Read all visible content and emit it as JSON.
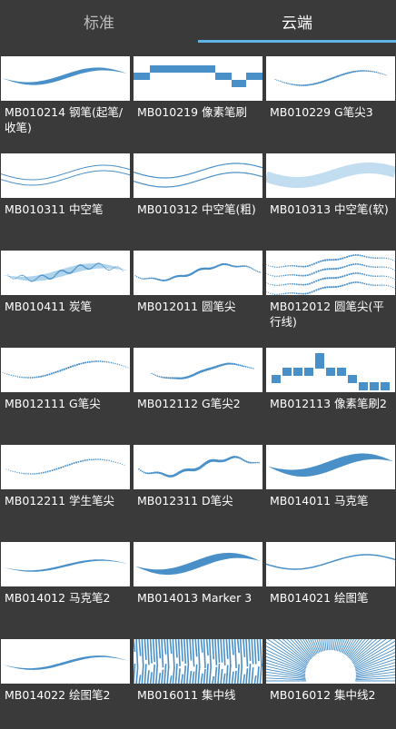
{
  "tabs": {
    "standard": "标准",
    "cloud": "云端"
  },
  "brushes": [
    {
      "label": "MB010214 钢笔(起笔/收笔)",
      "style": "taper"
    },
    {
      "label": "MB010219 像素笔刷",
      "style": "pixel"
    },
    {
      "label": "MB010229 G笔尖3",
      "style": "dotted-thin"
    },
    {
      "label": "MB010311 中空笔",
      "style": "hollow"
    },
    {
      "label": "MB010312 中空笔(粗)",
      "style": "hollow-thick"
    },
    {
      "label": "MB010313 中空笔(软)",
      "style": "hollow-soft"
    },
    {
      "label": "MB010411 炭笔",
      "style": "charcoal"
    },
    {
      "label": "MB012011 圆笔尖",
      "style": "round-dotted"
    },
    {
      "label": "MB012012 圆笔尖(平行线)",
      "style": "parallel"
    },
    {
      "label": "MB012111 G笔尖",
      "style": "g-pen"
    },
    {
      "label": "MB012112 G笔尖2",
      "style": "g-pen-2"
    },
    {
      "label": "MB012113 像素笔刷2",
      "style": "pixel-2"
    },
    {
      "label": "MB012211 学生笔尖",
      "style": "student"
    },
    {
      "label": "MB012311 D笔尖",
      "style": "d-pen"
    },
    {
      "label": "MB014011 马克笔",
      "style": "marker"
    },
    {
      "label": "MB014012 马克笔2",
      "style": "marker-2"
    },
    {
      "label": "MB014013 Marker 3",
      "style": "marker-3"
    },
    {
      "label": "MB014021 绘图笔",
      "style": "drawing-pen"
    },
    {
      "label": "MB014022 绘图笔2",
      "style": "drawing-pen-2"
    },
    {
      "label": "MB016011 集中线",
      "style": "concentrated"
    },
    {
      "label": "MB016012 集中线2",
      "style": "concentrated-2"
    }
  ],
  "colors": {
    "background": "#3a3a3a",
    "stroke": "#4a90c8",
    "stroke_light": "#8fc0e4",
    "indicator": "#5fb4e6",
    "inactive_tab": "#bdbdbd"
  }
}
